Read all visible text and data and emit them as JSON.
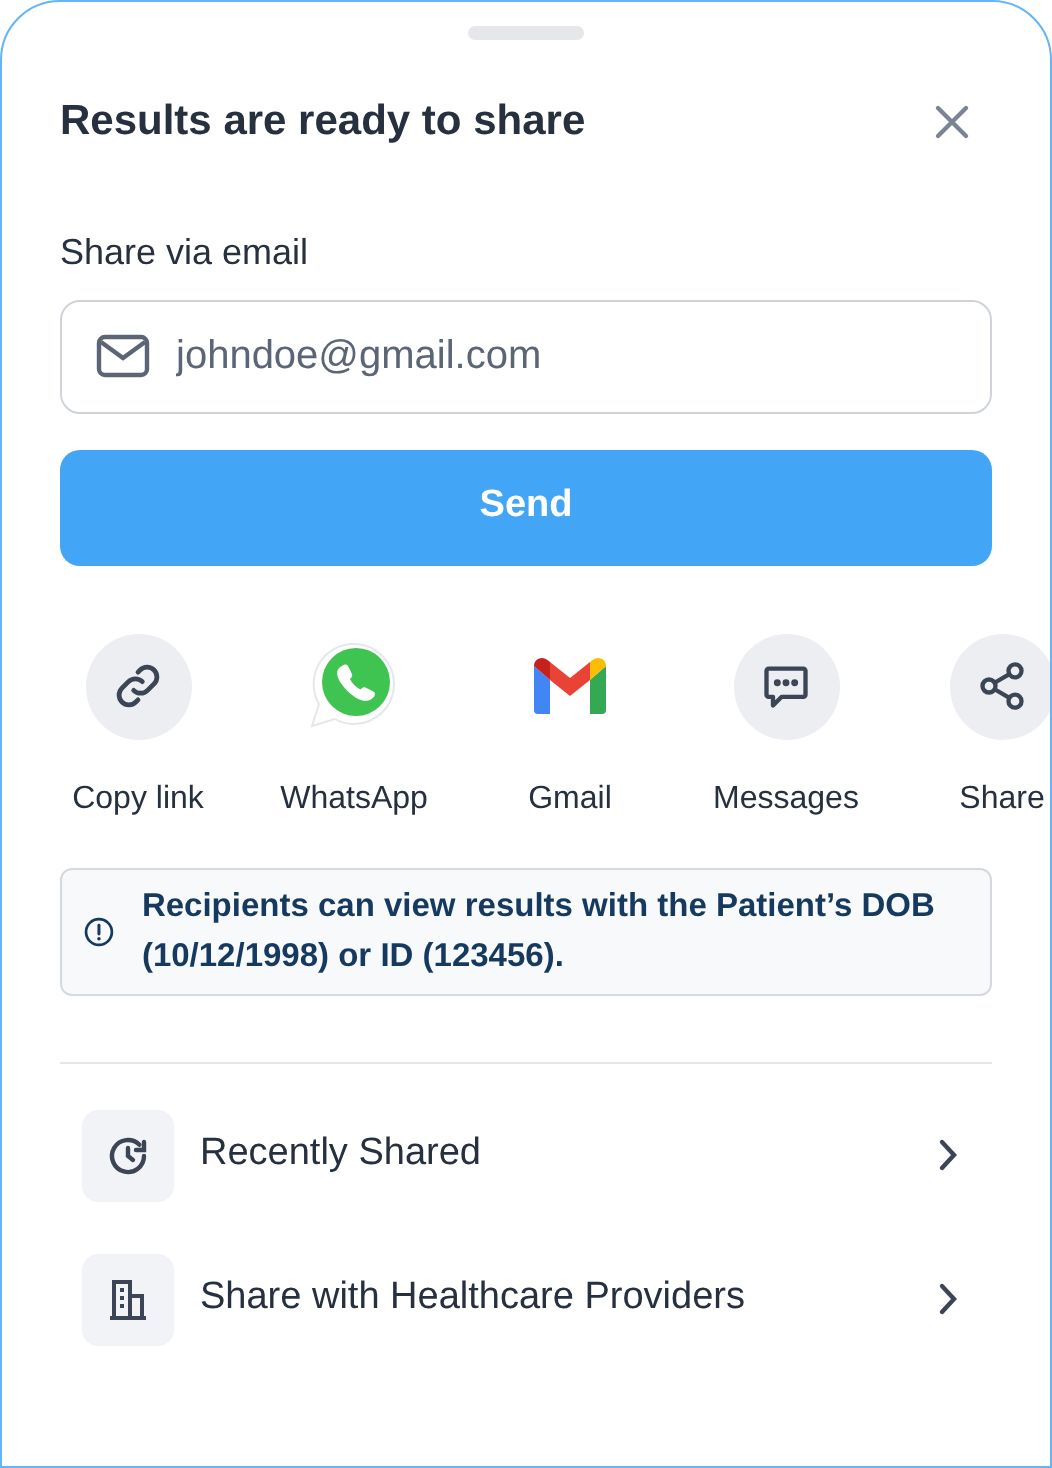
{
  "sheet": {
    "title": "Results are ready to share"
  },
  "email": {
    "label": "Share via email",
    "value": "johndoe@gmail.com",
    "button": "Send"
  },
  "share_options": [
    {
      "kind": "link",
      "label": "Copy link"
    },
    {
      "kind": "whatsapp",
      "label": "WhatsApp"
    },
    {
      "kind": "gmail",
      "label": "Gmail"
    },
    {
      "kind": "messages",
      "label": "Messages"
    },
    {
      "kind": "share",
      "label": "Share"
    }
  ],
  "notice": "Recipients can view results with the Patient’s DOB (10/12/1998) or ID (123456).",
  "menu": [
    {
      "kind": "history",
      "label": "Recently Shared"
    },
    {
      "kind": "building",
      "label": "Share with Healthcare Providers"
    }
  ]
}
